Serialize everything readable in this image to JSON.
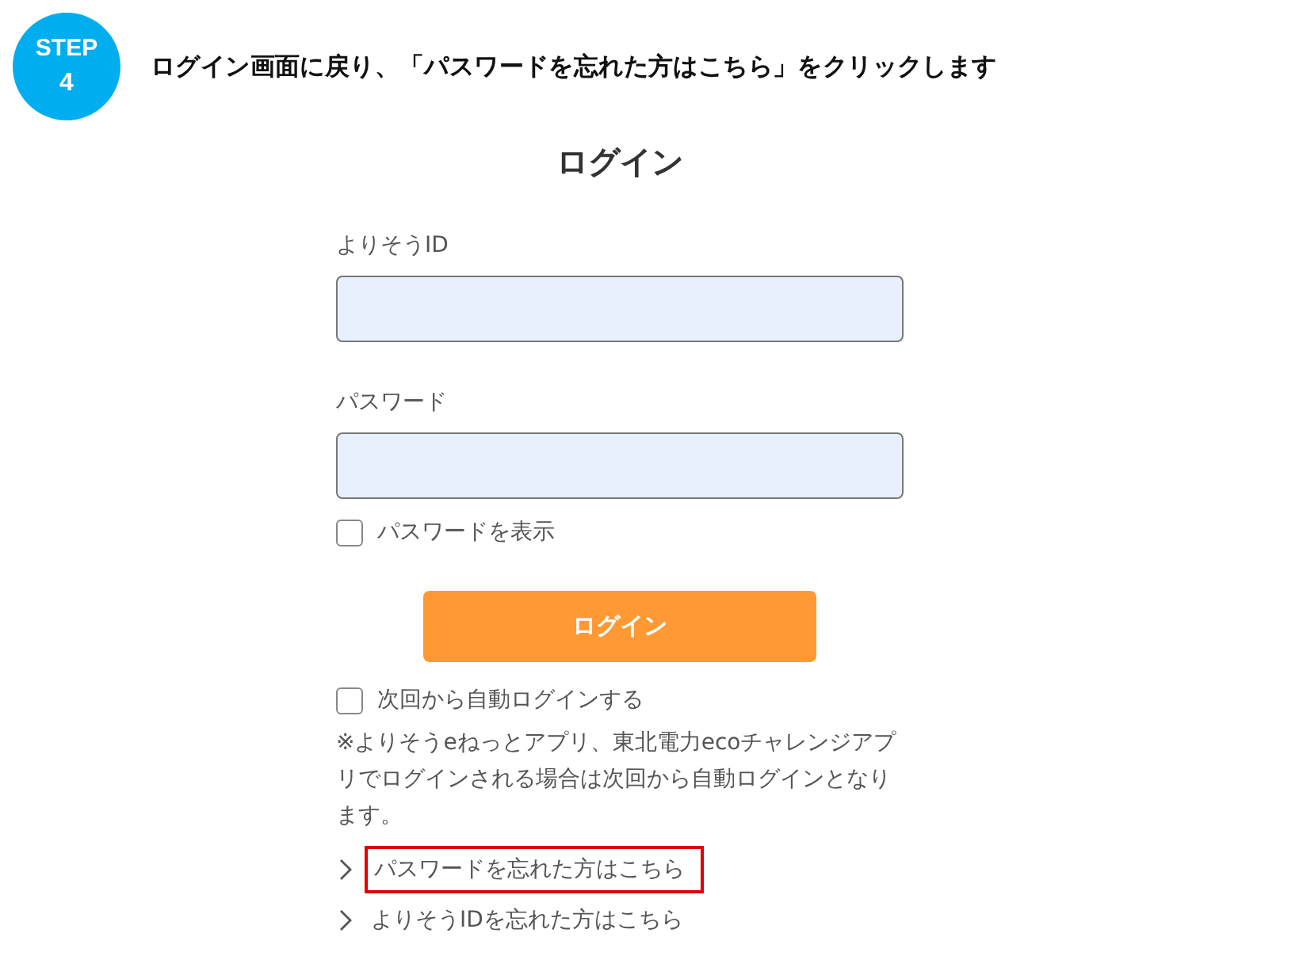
{
  "step_badge": {
    "label": "STEP",
    "number": "4"
  },
  "instruction": "ログイン画面に戻り、「パスワードを忘れた方はこちら」をクリックします",
  "login_form": {
    "title": "ログイン",
    "fields": [
      {
        "label": "よりそうID"
      },
      {
        "label": "パスワード"
      }
    ],
    "show_password": {
      "label": "パスワードを表示",
      "checked": false
    },
    "submit_button": "ログイン",
    "auto_login": {
      "label": "次回から自動ログインする",
      "checked": false
    },
    "note": "※よりそうeねっとアプリ、東北電力ecoチャレンジアプリでログインされる場合は次回から自動ログインとなります。",
    "links": [
      {
        "label": "パスワードを忘れた方はこちら",
        "highlighted": true
      },
      {
        "label": "よりそうIDを忘れた方はこちら",
        "highlighted": false
      }
    ]
  }
}
